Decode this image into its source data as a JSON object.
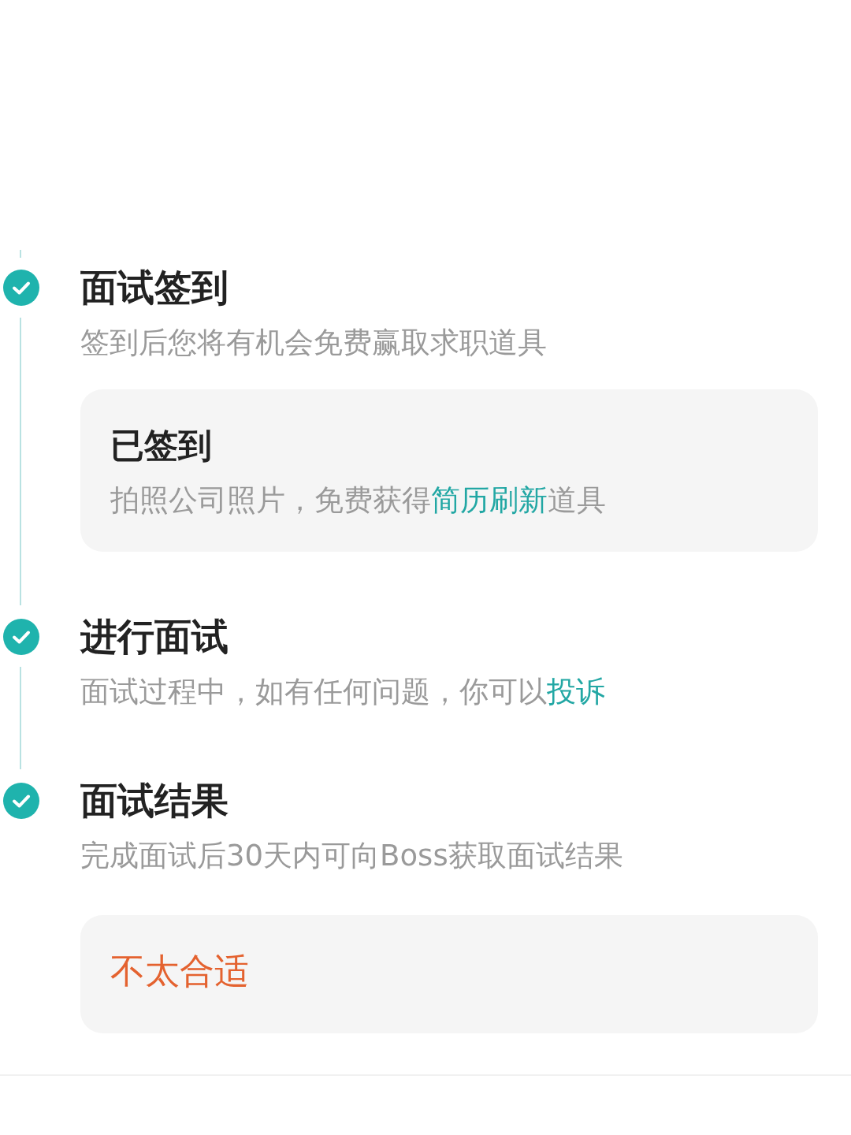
{
  "steps": [
    {
      "title": "面试签到",
      "done": true,
      "description": [
        {
          "kind": "text",
          "text": "签到后您将有机会免费赢取求职道具"
        }
      ],
      "card": {
        "kind": "note",
        "title": "已签到",
        "text": [
          {
            "kind": "text",
            "text": "拍照公司照片，免费获得"
          },
          {
            "kind": "link",
            "text": "简历刷新"
          },
          {
            "kind": "text",
            "text": "道具"
          }
        ]
      }
    },
    {
      "title": "进行面试",
      "done": true,
      "description": [
        {
          "kind": "text",
          "text": "面试过程中，如有任何问题，你可以"
        },
        {
          "kind": "link",
          "text": "投诉"
        }
      ]
    },
    {
      "title": "面试结果",
      "done": true,
      "description": [
        {
          "kind": "text",
          "text": "完成面试后30天内可向Boss获取面试结果"
        }
      ],
      "card": {
        "kind": "verdict",
        "label": "不太合适"
      }
    }
  ]
}
